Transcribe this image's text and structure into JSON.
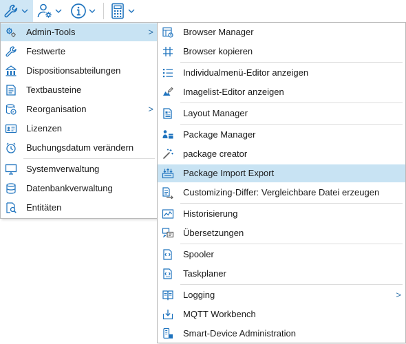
{
  "colors": {
    "accent": "#1e73be",
    "highlight": "#c8e3f3",
    "toolbar_active": "#cfe6f5"
  },
  "toolbar": {
    "buttons": [
      {
        "icon": "wrench-icon"
      },
      {
        "icon": "user-settings-icon"
      },
      {
        "icon": "info-icon"
      },
      {
        "icon": "calculator-icon"
      }
    ]
  },
  "main_menu": {
    "items": [
      {
        "label": "Admin-Tools",
        "icon": "gears-icon",
        "submenu": ">",
        "highlighted": true
      },
      {
        "label": "Festwerte",
        "icon": "wrench-icon"
      },
      {
        "label": "Dispositionsabteilungen",
        "icon": "hierarchy-icon"
      },
      {
        "label": "Textbausteine",
        "icon": "text-block-icon"
      },
      {
        "label": "Reorganisation",
        "icon": "reorganize-icon",
        "submenu": ">"
      },
      {
        "label": "Lizenzen",
        "icon": "license-card-icon"
      },
      {
        "label": "Buchungsdatum verändern",
        "icon": "clock-icon"
      },
      {
        "label": "Systemverwaltung",
        "icon": "monitor-icon"
      },
      {
        "label": "Datenbankverwaltung",
        "icon": "database-icon"
      },
      {
        "label": "Entitäten",
        "icon": "entity-search-icon"
      }
    ]
  },
  "admin_tools_menu": {
    "items": [
      {
        "label": "Browser Manager",
        "icon": "browser-manager-icon"
      },
      {
        "label": "Browser kopieren",
        "icon": "grid-copy-icon"
      },
      {
        "label": "Individualmenü-Editor anzeigen",
        "icon": "list-icon"
      },
      {
        "label": "Imagelist-Editor anzeigen",
        "icon": "image-edit-icon"
      },
      {
        "label": "Layout Manager",
        "icon": "layout-icon"
      },
      {
        "label": "Package Manager",
        "icon": "package-manager-icon"
      },
      {
        "label": "package creator",
        "icon": "magic-wand-icon"
      },
      {
        "label": "Package Import Export",
        "icon": "import-export-icon",
        "highlighted": true
      },
      {
        "label": "Customizing-Differ: Vergleichbare Datei erzeugen",
        "icon": "diff-icon"
      },
      {
        "label": "Historisierung",
        "icon": "history-chart-icon"
      },
      {
        "label": "Übersetzungen",
        "icon": "translation-icon"
      },
      {
        "label": "Spooler",
        "icon": "spooler-icon"
      },
      {
        "label": "Taskplaner",
        "icon": "task-planner-icon"
      },
      {
        "label": "Logging",
        "icon": "logging-icon",
        "submenu": ">"
      },
      {
        "label": "MQTT Workbench",
        "icon": "mqtt-icon"
      },
      {
        "label": "Smart-Device Administration",
        "icon": "smart-device-icon"
      }
    ]
  }
}
